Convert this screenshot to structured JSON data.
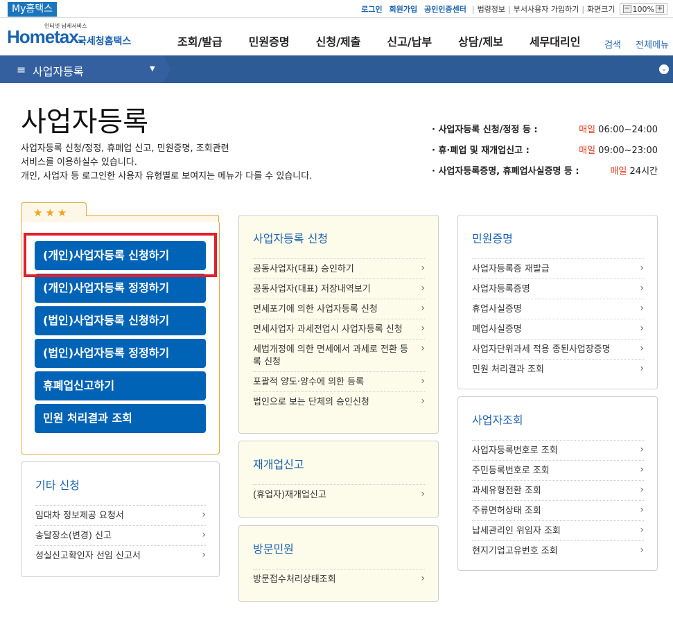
{
  "topbar": {
    "my_hometax": "My홈택스",
    "login": "로그인",
    "signup": "회원가입",
    "cert_center": "공인인증센터",
    "law_info": "법령정보",
    "dept_user_signup": "부서사용자 가입하기",
    "screen_size": "화면크기",
    "zoom_minus": "−",
    "zoom_level": "100%",
    "zoom_plus": "+"
  },
  "logo": {
    "small_text": "인터넷 납세서비스",
    "main_text": "Hometax.",
    "sub_text": "국세청홈택스"
  },
  "nav": {
    "items": [
      "조회/발급",
      "민원증명",
      "신청/제출",
      "신고/납부",
      "상담/제보",
      "세무대리인"
    ],
    "search": "검색",
    "all_menu": "전체메뉴"
  },
  "breadcrumb": {
    "menu_icon": "≡",
    "label": "사업자등록",
    "caret": "▼",
    "expand": "⌄"
  },
  "page": {
    "title": "사업자등록",
    "desc_line1": "사업자등록 신청/정정, 휴폐업 신고, 민원증명, 조회관련",
    "desc_line2": "서비스를 이용하실수 있습니다.",
    "desc_line3": "개인, 사업자 등 로그인한 사용자 유형별로 보여지는 메뉴가 다를 수 있습니다."
  },
  "hours": [
    {
      "label": "· 사업자등록 신청/정정 등 :",
      "day": "매일",
      "time": "06:00~24:00"
    },
    {
      "label": "· 휴·폐업 및 재개업신고 :",
      "day": "매일",
      "time": "09:00~23:00"
    },
    {
      "label": "· 사업자등록증명, 휴폐업사실증명 등 :",
      "day": "매일",
      "time": "24시간"
    }
  ],
  "favorites": {
    "stars": "★★★",
    "buttons": [
      "(개인)사업자등록 신청하기",
      "(개인)사업자등록 정정하기",
      "(법인)사업자등록 신청하기",
      "(법인)사업자등록 정정하기",
      "휴폐업신고하기",
      "민원 처리결과 조회"
    ]
  },
  "etc": {
    "title": "기타 신청",
    "items": [
      "임대차 정보제공 요청서",
      "송달장소(변경) 신고",
      "성실신고확인자 선임 신고서"
    ]
  },
  "registration": {
    "title": "사업자등록 신청",
    "items": [
      "공동사업자(대표) 승인하기",
      "공동사업자(대표) 저장내역보기",
      "면세포기에 의한 사업자등록 신청",
      "면세사업자 과세전업시 사업자등록 신청",
      "세법개정에 의한 면세에서 과세로 전환 등록 신청",
      "포괄적 양도·양수에 의한 등록",
      "법인으로 보는 단체의 승인신청"
    ]
  },
  "reopen": {
    "title": "재개업신고",
    "items": [
      "(휴업자)재개업신고"
    ]
  },
  "visit": {
    "title": "방문민원",
    "items": [
      "방문접수처리상태조회"
    ]
  },
  "civil": {
    "title": "민원증명",
    "items": [
      "사업자등록증 재발급",
      "사업자등록증명",
      "휴업사실증명",
      "폐업사실증명",
      "사업자단위과세 적용 종된사업장증명",
      "민원 처리결과 조회"
    ]
  },
  "lookup": {
    "title": "사업자조회",
    "items": [
      "사업자등록번호로 조회",
      "주민등록번호로 조회",
      "과세유형전환 조회",
      "주류면허상태 조회",
      "납세관리인 위임자 조회",
      "현지기업고유번호 조회"
    ]
  },
  "chevron": "›"
}
